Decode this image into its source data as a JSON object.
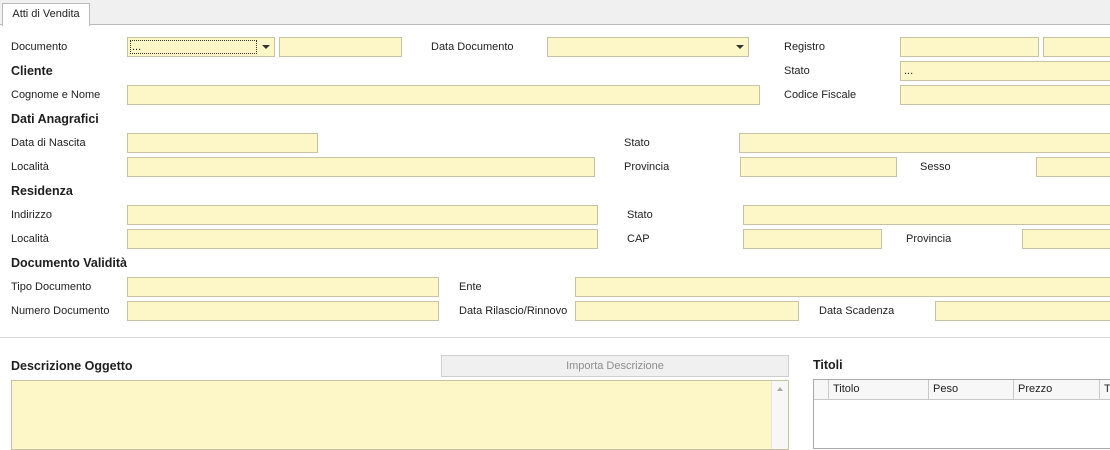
{
  "tab": {
    "label": "Atti di Vendita"
  },
  "documento": {
    "label": "Documento",
    "combo_value": "...",
    "number_value": ""
  },
  "data_documento": {
    "label": "Data Documento",
    "value": ""
  },
  "registro": {
    "label": "Registro",
    "value1": "",
    "value2": ""
  },
  "cliente": {
    "section": "Cliente",
    "stato_label": "Stato",
    "stato_value": "...",
    "cognome_nome_label": "Cognome e Nome",
    "cognome_nome_value": "",
    "codice_fiscale_label": "Codice Fiscale",
    "codice_fiscale_value": ""
  },
  "dati_anagrafici": {
    "section": "Dati Anagrafici",
    "data_nascita_label": "Data di Nascita",
    "data_nascita_value": "",
    "stato_label": "Stato",
    "stato_value": "",
    "localita_label": "Località",
    "localita_value": "",
    "provincia_label": "Provincia",
    "provincia_value": "",
    "sesso_label": "Sesso",
    "sesso_value": ""
  },
  "residenza": {
    "section": "Residenza",
    "indirizzo_label": "Indirizzo",
    "indirizzo_value": "",
    "stato_label": "Stato",
    "stato_value": "",
    "localita_label": "Località",
    "localita_value": "",
    "cap_label": "CAP",
    "cap_value": "",
    "provincia_label": "Provincia",
    "provincia_value": ""
  },
  "documento_validita": {
    "section": "Documento Validità",
    "tipo_label": "Tipo Documento",
    "tipo_value": "",
    "ente_label": "Ente",
    "ente_value": "",
    "numero_label": "Numero Documento",
    "numero_value": "",
    "rilascio_label": "Data Rilascio/Rinnovo",
    "rilascio_value": "",
    "scadenza_label": "Data Scadenza",
    "scadenza_value": ""
  },
  "descrizione": {
    "section": "Descrizione Oggetto",
    "import_button": "Importa Descrizione",
    "value": ""
  },
  "titoli": {
    "section": "Titoli",
    "columns": [
      "Titolo",
      "Peso",
      "Prezzo",
      "Tota"
    ]
  },
  "colors": {
    "field_bg": "#fdf7c8",
    "field_border": "#c9c1a3",
    "tab_bg": "#f0f0f0",
    "button_text": "#8d8d8d"
  }
}
